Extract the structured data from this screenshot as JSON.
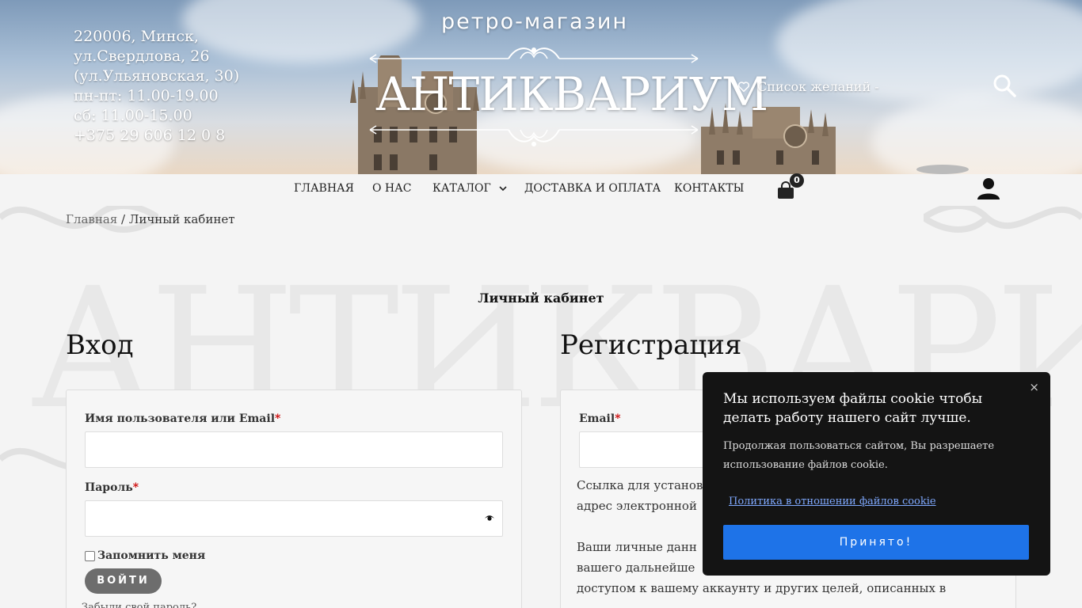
{
  "header": {
    "address_lines": [
      "220006, Минск,",
      "ул.Свердлова, 26",
      "(ул.Ульяновская, 30)",
      "пн-пт: 11.00-19.00",
      "сб: 11.00-15.00",
      "+375 29 606 12 0 8"
    ],
    "logo_top": "ретро-магазин",
    "logo_main": "АНТИКВАРИУМ",
    "wishlist_label": "Список желаний -"
  },
  "nav": {
    "items": [
      {
        "label": "ГЛАВНАЯ"
      },
      {
        "label": "О НАС"
      },
      {
        "label": "КАТАЛОГ"
      },
      {
        "label": "ДОСТАВКА И ОПЛАТА"
      },
      {
        "label": "КОНТАКТЫ"
      }
    ],
    "cart_count": "0"
  },
  "breadcrumb": {
    "home": "Главная",
    "separator": " / ",
    "current": "Личный кабинет"
  },
  "watermark": "АНТИКВАРИУМ",
  "page_title": "Личный кабинет",
  "login": {
    "title": "Вход",
    "username_label": "Имя пользователя или Email",
    "password_label": "Пароль",
    "required_mark": "*",
    "remember_label": "Запомнить меня",
    "submit_label": "ВОЙТИ",
    "lost_password": "Забыли свой пароль?"
  },
  "register": {
    "title": "Регистрация",
    "email_label": "Email",
    "text_lines": [
      "Ссылка для установ",
      "адрес электронной",
      "Ваши личные данн",
      "вашего дальнейше",
      "доступом к вашему аккаунту и других целей, описанных в"
    ]
  },
  "cookie": {
    "title_lines": [
      "Мы используем файлы cookie чтобы",
      "делать работу нашего сайт лучше."
    ],
    "text_lines": [
      "Продолжая пользоваться сайтом, Вы разрешаете",
      "использование файлов cookie."
    ],
    "policy_link": "Политика в отношении файлов cookie",
    "accept_label": "Принято!",
    "close_symbol": "×"
  },
  "colors": {
    "accent_button": "#1e73e8",
    "login_button": "#6d6d6d",
    "cookie_bg": "#141414",
    "required": "#cc0000"
  }
}
